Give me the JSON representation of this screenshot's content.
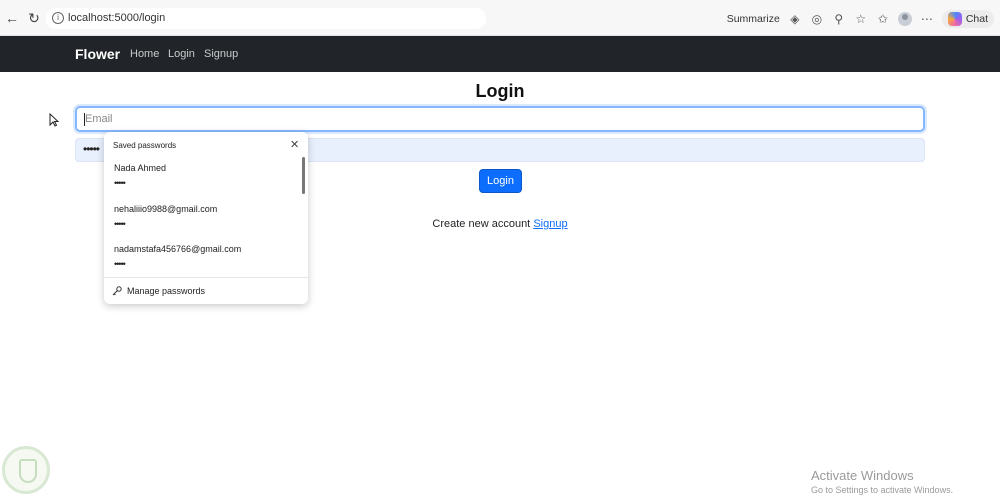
{
  "browser": {
    "url": "localhost:5000/login",
    "summarize_label": "Summarize",
    "chat_label": "Chat"
  },
  "navbar": {
    "brand": "Flower",
    "links": [
      "Home",
      "Login",
      "Signup"
    ]
  },
  "form": {
    "title": "Login",
    "email_placeholder": "Email",
    "password_value": "•••••",
    "submit_label": "Login",
    "create_text": "Create new account",
    "signup_link": "Signup"
  },
  "saved_passwords": {
    "header": "Saved passwords",
    "entries": [
      {
        "name": "Nada Ahmed",
        "password": "•••••"
      },
      {
        "name": "nehaliiio9988@gmail.com",
        "password": "•••••"
      },
      {
        "name": "nadamstafa456766@gmail.com",
        "password": "•••••"
      }
    ],
    "manage_label": "Manage passwords"
  },
  "watermark": {
    "line1": "Activate Windows",
    "line2": "Go to Settings to activate Windows."
  },
  "colors": {
    "navbar_bg": "#212529",
    "primary": "#0d6efd",
    "autofill_bg": "#e8f0fe"
  }
}
